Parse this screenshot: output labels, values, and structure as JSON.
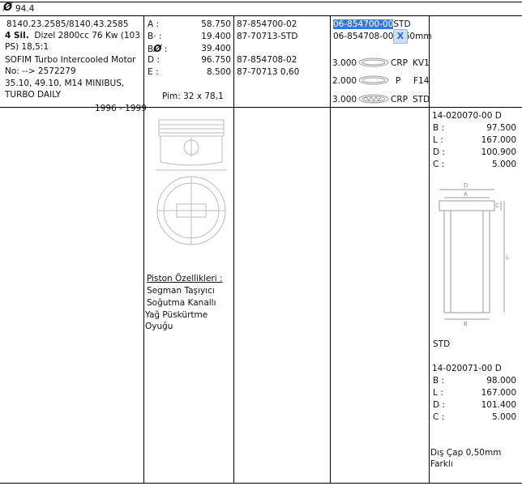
{
  "header": {
    "diameter_symbol": "Ø",
    "diameter": "94.4"
  },
  "vehicle": {
    "codes": "8140.23.2585/8140.43.2585",
    "cylinders": "4 Sil.",
    "engine": "Dizel 2800cc 76 Kw (103 PS) 18,5:1",
    "note": "SOFIM Turbo Intercooled Motor No: --> 2572279",
    "models": "35.10, 49.10, M14 MINIBUS, TURBO DAILY",
    "years": "1996 - 1999"
  },
  "dims": [
    {
      "label": "A :",
      "value": "58.750"
    },
    {
      "label": "B· :",
      "value": "19.400"
    },
    {
      "label": "B",
      "symbol": "Ø",
      "suffix": " :",
      "value": "39.400"
    },
    {
      "label": "D :",
      "value": "96.750"
    },
    {
      "label": "E :",
      "value": "8.500"
    }
  ],
  "pin": "Pim: 32 x 78,1",
  "piston_features": {
    "title": "Piston Özellikleri :",
    "items": [
      "Segman Taşıyıcı",
      "Soğutma Kanallı",
      "Yağ Püskürtme Oyuğu"
    ]
  },
  "part_numbers": [
    "87-854700-02",
    "87-70713-STD",
    "87-854708-02",
    "87-70713 0,60"
  ],
  "rings_refs": {
    "selected": "06-854700-00",
    "selected_suffix": "STD",
    "second": "06-854708-00 0,60mm",
    "badge": "X"
  },
  "rings": [
    {
      "thickness": "3.000",
      "type": "CRP",
      "code": "KV1"
    },
    {
      "thickness": "2.000",
      "type": "P",
      "code": "F14"
    },
    {
      "thickness": "3.000",
      "type": "CRP",
      "code": "STD"
    }
  ],
  "liner1": {
    "code": "14-020070-00 D",
    "specs": [
      {
        "label": "B :",
        "value": "97.500"
      },
      {
        "label": "L :",
        "value": "167.000"
      },
      {
        "label": "D :",
        "value": "100.900"
      },
      {
        "label": "C :",
        "value": "5.000"
      }
    ],
    "diagram_labels": {
      "d": "D",
      "a": "A",
      "c": "C",
      "l": "L",
      "b": "B"
    },
    "std": "STD"
  },
  "liner2": {
    "code": "14-020071-00 D",
    "specs": [
      {
        "label": "B :",
        "value": "98.000"
      },
      {
        "label": "L :",
        "value": "167.000"
      },
      {
        "label": "D :",
        "value": "101.400"
      },
      {
        "label": "C :",
        "value": "5.000"
      }
    ],
    "note": "Dış Çap 0,50mm Farklı"
  }
}
